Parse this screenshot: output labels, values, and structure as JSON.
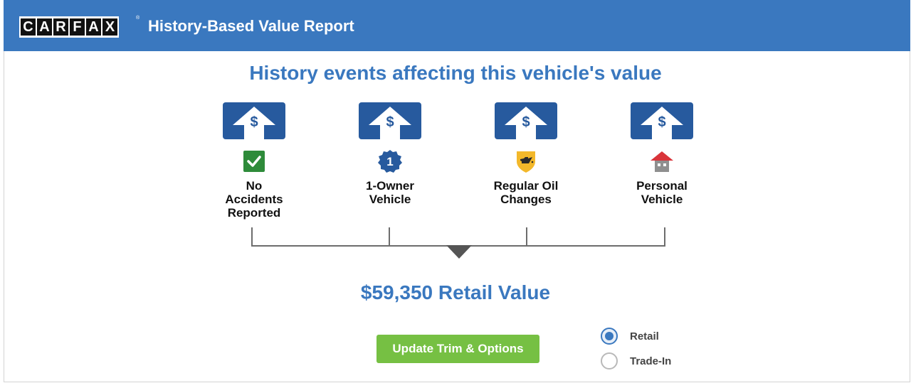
{
  "header": {
    "logo_letters": [
      "C",
      "A",
      "R",
      "F",
      "A",
      "X"
    ],
    "logo_trademark": "®",
    "title": "History-Based Value Report"
  },
  "main": {
    "title": "History events affecting this vehicle's value",
    "events": [
      {
        "label": "No\nAccidents\nReported",
        "arrow_symbol": "$",
        "badge_icon": "green-check-icon"
      },
      {
        "label": "1-Owner\nVehicle",
        "arrow_symbol": "$",
        "badge_icon": "blue-ribbon-icon",
        "badge_text": "1"
      },
      {
        "label": "Regular Oil\nChanges",
        "arrow_symbol": "$",
        "badge_icon": "oil-can-shield-icon"
      },
      {
        "label": "Personal\nVehicle",
        "arrow_symbol": "$",
        "badge_icon": "house-icon"
      }
    ],
    "retail_value": "$59,350 Retail Value",
    "update_button": "Update Trim & Options",
    "value_type_options": [
      {
        "label": "Retail",
        "selected": true
      },
      {
        "label": "Trade-In",
        "selected": false
      }
    ]
  },
  "colors": {
    "header_bg": "#3a78bf",
    "title_blue": "#3a78bf",
    "arrow_card": "#275a9e",
    "button_green": "#76c043",
    "check_green": "#2e8b3a"
  }
}
